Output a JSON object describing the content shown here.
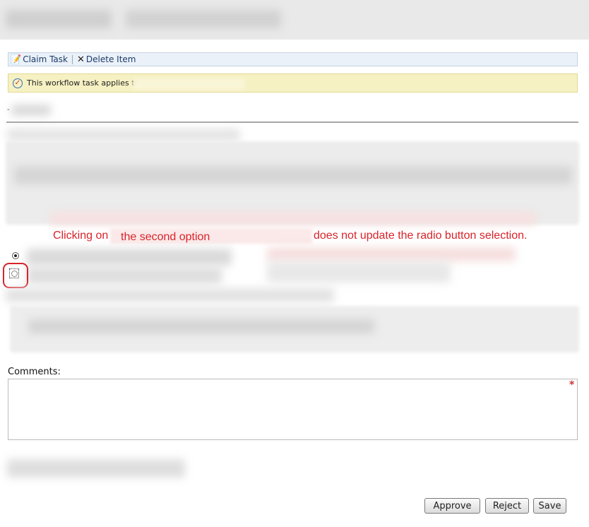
{
  "toolbar": {
    "claim_task": "Claim Task",
    "delete_item": "Delete Item",
    "claim_icon": "claim-task-icon",
    "delete_icon": "delete-x-icon"
  },
  "workflow_bar": {
    "text": "This workflow task applies to",
    "icon": "workflow-check-icon"
  },
  "annotation": {
    "part1": "Clicking on",
    "part2": "the second option",
    "part3": "does not update the radio button selection.",
    "color": "#d8232a"
  },
  "radio_options": [
    {
      "selected": true
    },
    {
      "selected": false
    }
  ],
  "comments": {
    "label": "Comments:",
    "value": "",
    "required_marker": "*"
  },
  "buttons": {
    "approve": "Approve",
    "reject": "Reject",
    "save": "Save"
  }
}
